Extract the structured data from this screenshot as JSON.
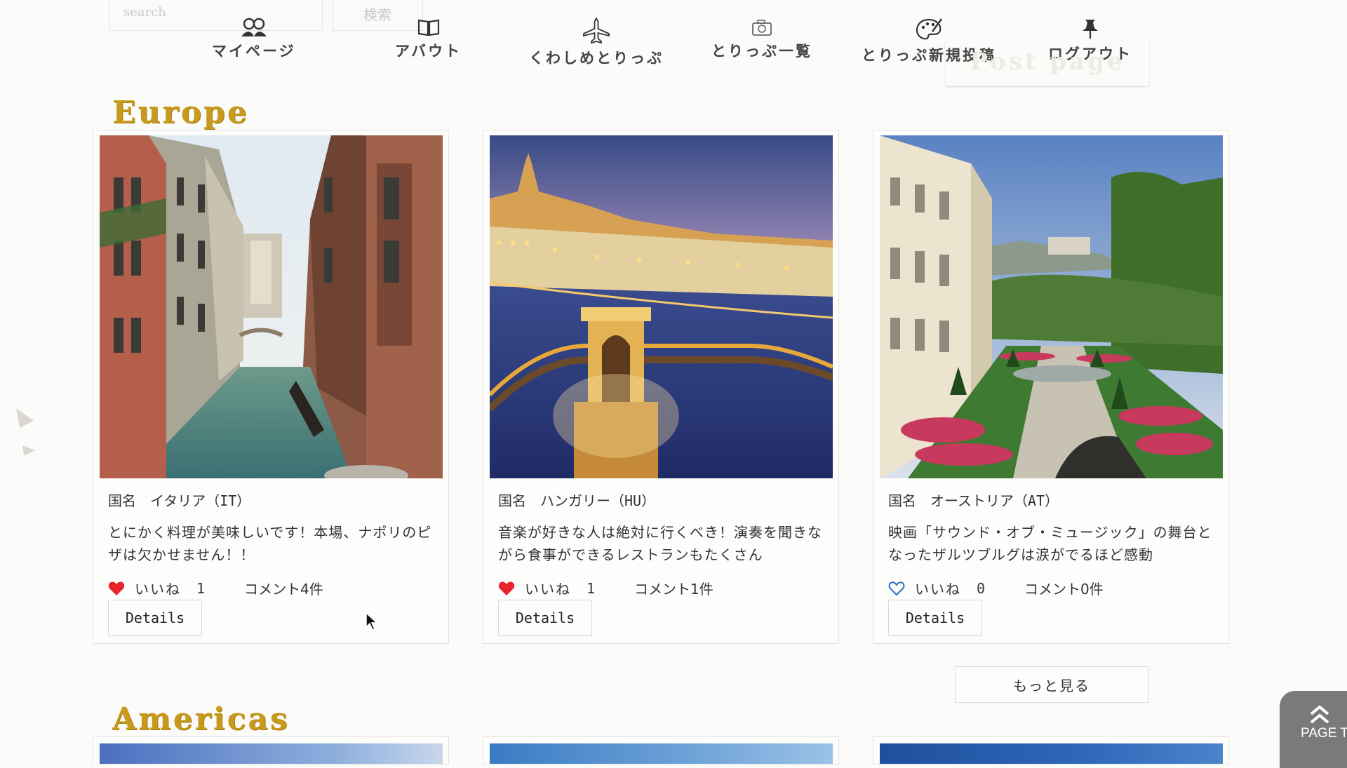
{
  "search": {
    "placeholder": "search",
    "button_label": "検索"
  },
  "nav": {
    "items": [
      {
        "label": "マイページ",
        "icon": "users-icon"
      },
      {
        "label": "アバウト",
        "icon": "book-icon"
      },
      {
        "label": "くわしめとりっぷ",
        "icon": "airplane-icon"
      },
      {
        "label": "とりっぷ一覧",
        "icon": "camera-icon"
      },
      {
        "label": "とりっぷ新規投稿",
        "icon": "palette-icon"
      },
      {
        "label": "ログアウト",
        "icon": "pin-icon"
      }
    ],
    "ghost_label": "Post page"
  },
  "sections": {
    "europe": "Europe",
    "americas": "Americas"
  },
  "cards": [
    {
      "country": "国名　イタリア（IT）",
      "text": "とにかく料理が美味しいです！本場、ナポリのピザは欠かせません！！",
      "like_label": "いいね",
      "likes": "1",
      "liked": true,
      "comments": "コメント4件",
      "details_label": "Details",
      "photo": "venice-canal"
    },
    {
      "country": "国名　ハンガリー（HU）",
      "text": "音楽が好きな人は絶対に行くべき！演奏を聞きながら食事ができるレストランもたくさん",
      "like_label": "いいね",
      "likes": "1",
      "liked": true,
      "comments": "コメント1件",
      "details_label": "Details",
      "photo": "budapest-chain-bridge"
    },
    {
      "country": "国名　オーストリア（AT）",
      "text": "映画「サウンド・オブ・ミュージック」の舞台となったザルツブルグは涙がでるほど感動",
      "like_label": "いいね",
      "likes": "0",
      "liked": false,
      "comments": "コメント0件",
      "details_label": "Details",
      "photo": "salzburg-garden"
    }
  ],
  "more_label": "もっと見る",
  "page_top_label": "PAGE T",
  "colors": {
    "accent_gold": "#c79a1e",
    "heart_red": "#e8252b",
    "heart_outline": "#2a6fc0",
    "page_top_bg": "#7a7a7a"
  }
}
